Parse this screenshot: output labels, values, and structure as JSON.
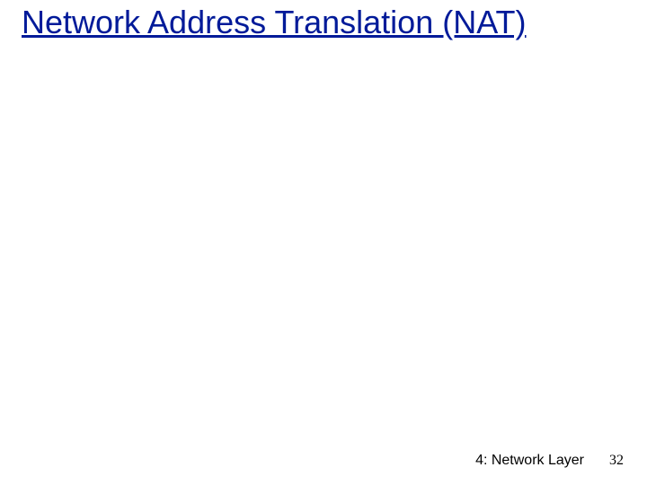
{
  "slide": {
    "title": "Network Address Translation (NAT)"
  },
  "footer": {
    "section_label": "4: Network Layer",
    "page_number": "32"
  }
}
